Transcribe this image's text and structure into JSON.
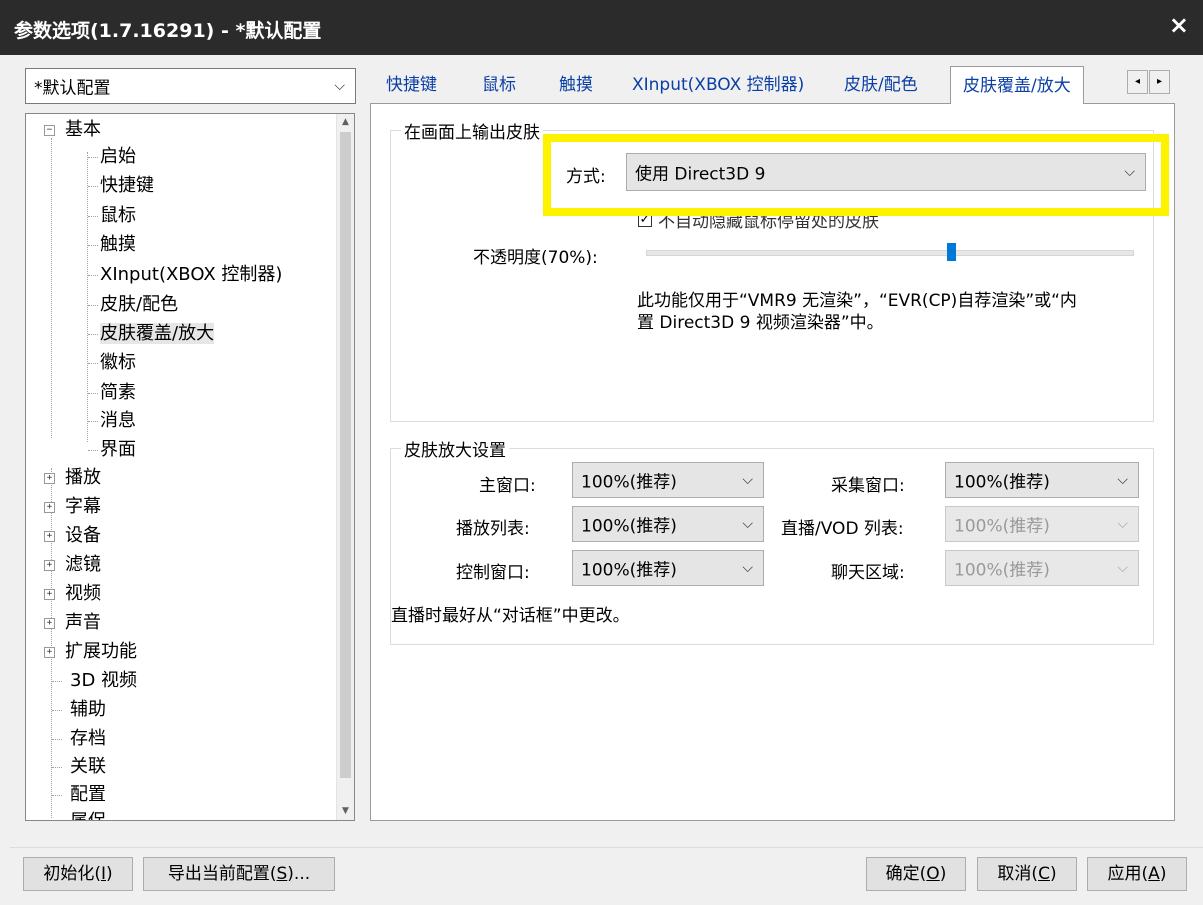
{
  "window": {
    "title": "参数选项(1.7.16291) - *默认配置",
    "close": "×"
  },
  "profile": {
    "value": "*默认配置"
  },
  "tree": {
    "items": [
      {
        "label": "基本",
        "expander": "−"
      },
      {
        "label": "启始"
      },
      {
        "label": "快捷键"
      },
      {
        "label": "鼠标"
      },
      {
        "label": "触摸"
      },
      {
        "label": "XInput(XBOX 控制器)"
      },
      {
        "label": "皮肤/配色"
      },
      {
        "label": "皮肤覆盖/放大"
      },
      {
        "label": "徽标"
      },
      {
        "label": "简素"
      },
      {
        "label": "消息"
      },
      {
        "label": "界面"
      },
      {
        "label": "播放",
        "expander": "+"
      },
      {
        "label": "字幕",
        "expander": "+"
      },
      {
        "label": "设备",
        "expander": "+"
      },
      {
        "label": "滤镜",
        "expander": "+"
      },
      {
        "label": "视频",
        "expander": "+"
      },
      {
        "label": "声音",
        "expander": "+"
      },
      {
        "label": "扩展功能",
        "expander": "+"
      },
      {
        "label": "3D 视频"
      },
      {
        "label": "辅助"
      },
      {
        "label": "存档"
      },
      {
        "label": "关联"
      },
      {
        "label": "配置"
      },
      {
        "label": "属保"
      }
    ]
  },
  "tabs": [
    {
      "label": "快捷键"
    },
    {
      "label": "鼠标"
    },
    {
      "label": "触摸"
    },
    {
      "label": "XInput(XBOX 控制器)"
    },
    {
      "label": "皮肤/配色"
    },
    {
      "label": "皮肤覆盖/放大",
      "active": true
    }
  ],
  "tab_scroll": {
    "left": "◂",
    "right": "▸"
  },
  "overlay_group": {
    "legend": "在画面上输出皮肤",
    "method_label": "方式:",
    "method_value": "使用 Direct3D 9",
    "checkbox_label": "不自动隐藏鼠标停留处的皮肤",
    "checkbox_checked": true,
    "opacity_label": "不透明度(70%):",
    "opacity_value": 0.7,
    "note_line1": "此功能仅用于“VMR9 无渲染”，“EVR(CP)自荐渲染”或“内",
    "note_line2": "置 Direct3D 9 视频渲染器”中。"
  },
  "zoom_group": {
    "legend": "皮肤放大设置",
    "main_window_label": "主窗口:",
    "main_window_value": "100%(推荐)",
    "capture_window_label": "采集窗口:",
    "capture_window_value": "100%(推荐)",
    "playlist_label": "播放列表:",
    "playlist_value": "100%(推荐)",
    "live_vod_label": "直播/VOD 列表:",
    "live_vod_value": "100%(推荐)",
    "control_window_label": "控制窗口:",
    "control_window_value": "100%(推荐)",
    "chat_label": "聊天区域:",
    "chat_value": "100%(推荐)",
    "hint": "直播时最好从“对话框”中更改。"
  },
  "buttons": {
    "init": {
      "text": "初始化(",
      "key": "I",
      "end": ")"
    },
    "export": {
      "text": "导出当前配置(",
      "key": "S",
      "end": ")..."
    },
    "ok": {
      "text": "确定(",
      "key": "O",
      "end": ")"
    },
    "cancel": {
      "text": "取消(",
      "key": "C",
      "end": ")"
    },
    "apply": {
      "text": "应用(",
      "key": "A",
      "end": ")"
    }
  },
  "colors": {
    "accent": "#0078d7",
    "tab_text": "#0b3fa6",
    "highlight": "#fff200",
    "titlebar": "#2b2b2b"
  }
}
